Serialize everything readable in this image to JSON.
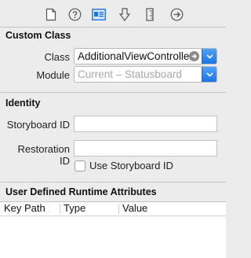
{
  "toolbar": {
    "icons": [
      "file-icon",
      "help-icon",
      "identity-icon",
      "attributes-icon",
      "size-icon",
      "connections-icon"
    ],
    "selected": "identity-icon"
  },
  "custom_class": {
    "title": "Custom Class",
    "class_label": "Class",
    "class_value": "AdditionalViewController",
    "module_label": "Module",
    "module_value": "Current – Statusboard"
  },
  "identity": {
    "title": "Identity",
    "storyboard_id_label": "Storyboard ID",
    "storyboard_id_value": "",
    "restoration_id_label": "Restoration ID",
    "restoration_id_value": "",
    "use_storyboard_id_label": "Use Storyboard ID",
    "use_storyboard_id_checked": false
  },
  "runtime_attributes": {
    "title": "User Defined Runtime Attributes",
    "columns": [
      "Key Path",
      "Type",
      "Value"
    ]
  },
  "colors": {
    "accent": "#1d73e6",
    "panel_bg": "#ececec"
  }
}
